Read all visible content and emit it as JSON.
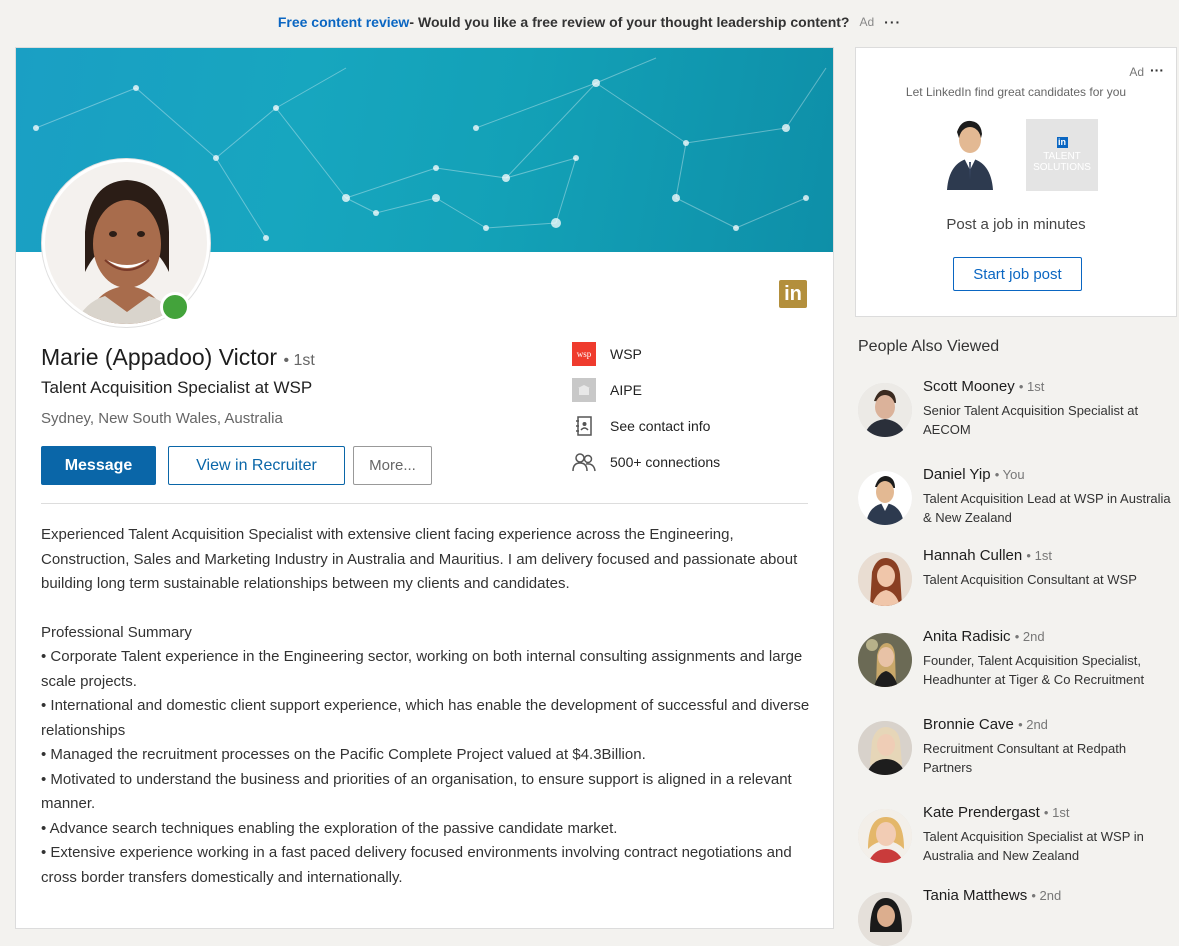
{
  "top_ad": {
    "link_text": "Free content review",
    "separator": " - ",
    "message": "Would you like a free review of your thought leadership content?",
    "ad_label": "Ad",
    "more": "···"
  },
  "profile": {
    "name": "Marie (Appadoo) Victor",
    "degree": "• 1st",
    "headline": "Talent Acquisition Specialist at WSP",
    "location": "Sydney, New South Wales, Australia",
    "message_label": "Message",
    "recruiter_label": "View in Recruiter",
    "more_label": "More...",
    "company": "WSP",
    "company_logo": "wsp",
    "school": "AIPE",
    "contact_info": "See contact info",
    "connections": "500+ connections"
  },
  "about": {
    "intro": "Experienced Talent Acquisition Specialist with extensive client facing experience across the Engineering, Construction, Sales and Marketing Industry in Australia and Mauritius. I am delivery focused and passionate about building long term sustainable relationships between my clients and candidates.",
    "summary_title": "Professional Summary",
    "bullets": [
      "• Corporate Talent experience in the Engineering sector, working on both internal consulting assignments and large scale projects.",
      "• International and domestic client support experience, which has enable the development of successful and diverse relationships",
      "• Managed the recruitment processes on the Pacific Complete Project valued at $4.3Billion.",
      "• Motivated to understand the business and priorities of an organisation, to ensure support is aligned in a relevant manner.",
      "• Advance search techniques enabling the exploration of the passive candidate market.",
      "• Extensive experience working in a fast paced delivery focused environments involving contract negotiations and cross border transfers domestically and internationally."
    ]
  },
  "side_ad": {
    "ad_label": "Ad",
    "more": "···",
    "tagline": "Let LinkedIn find great candidates for you",
    "logo_text": "in",
    "logo_caption_1": "TALENT",
    "logo_caption_2": "SOLUTIONS",
    "pitch": "Post a job in minutes",
    "button": "Start job post"
  },
  "people_also_viewed": {
    "title": "People Also Viewed",
    "people": [
      {
        "name": "Scott Mooney",
        "degree": "• 1st",
        "desc": "Senior Talent Acquisition Specialist at AECOM"
      },
      {
        "name": "Daniel Yip",
        "degree": "• You",
        "desc": "Talent Acquisition Lead at WSP in Australia & New Zealand"
      },
      {
        "name": "Hannah Cullen",
        "degree": "• 1st",
        "desc": "Talent Acquisition Consultant at WSP"
      },
      {
        "name": "Anita Radisic",
        "degree": "• 2nd",
        "desc": "Founder, Talent Acquisition Specialist, Headhunter at Tiger & Co Recruitment"
      },
      {
        "name": "Bronnie Cave",
        "degree": "• 2nd",
        "desc": "Recruitment Consultant at Redpath Partners"
      },
      {
        "name": "Kate Prendergast",
        "degree": "• 1st",
        "desc": "Talent Acquisition Specialist at WSP in Australia and New Zealand"
      },
      {
        "name": "Tania Matthews",
        "degree": "• 2nd",
        "desc": ""
      }
    ]
  },
  "colors": {
    "brand": "#0a66c2",
    "online": "#43a33b",
    "wsp_red": "#ef3b2d"
  }
}
